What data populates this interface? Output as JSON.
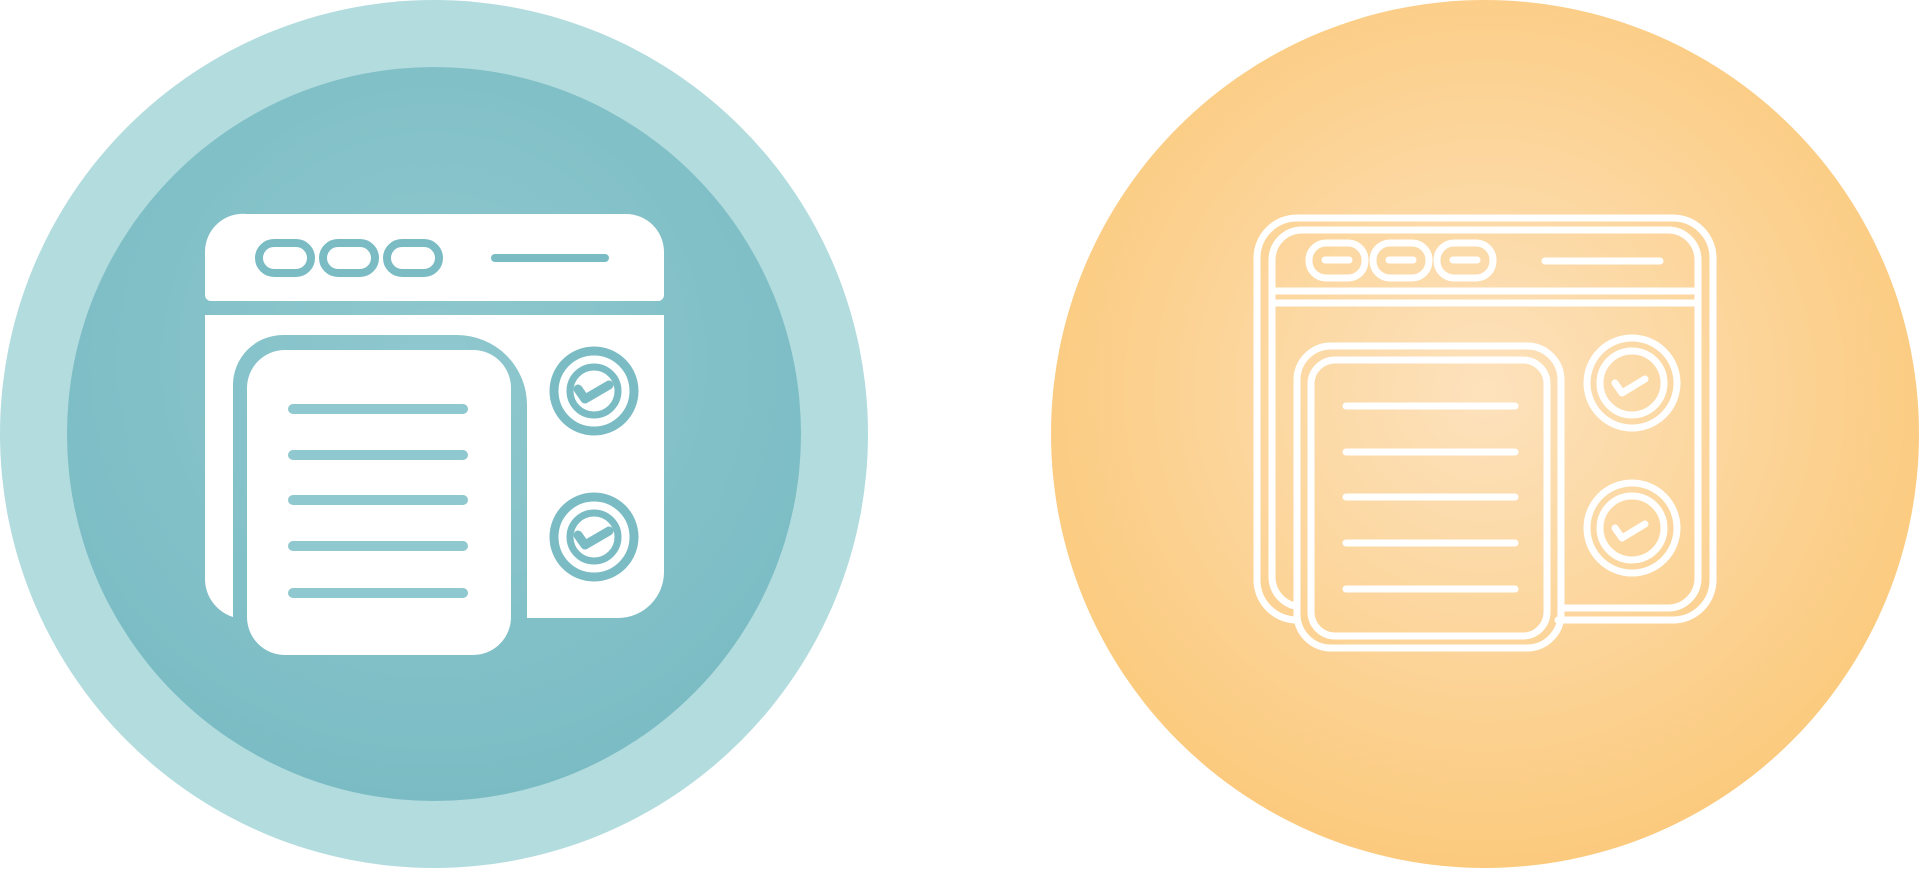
{
  "icons": [
    {
      "name": "web-document-checklist-icon",
      "style": "glyph",
      "colors": {
        "outer_circle": "#b3dcdf",
        "inner_circle": "#7bbcc4",
        "inner_circle_light": "#8fc8ce",
        "foreground": "#ffffff"
      }
    },
    {
      "name": "web-document-checklist-icon",
      "style": "outline",
      "colors": {
        "circle_center": "#fde2bd",
        "circle_edge": "#fbca7d",
        "foreground": "#ffffff"
      }
    }
  ]
}
